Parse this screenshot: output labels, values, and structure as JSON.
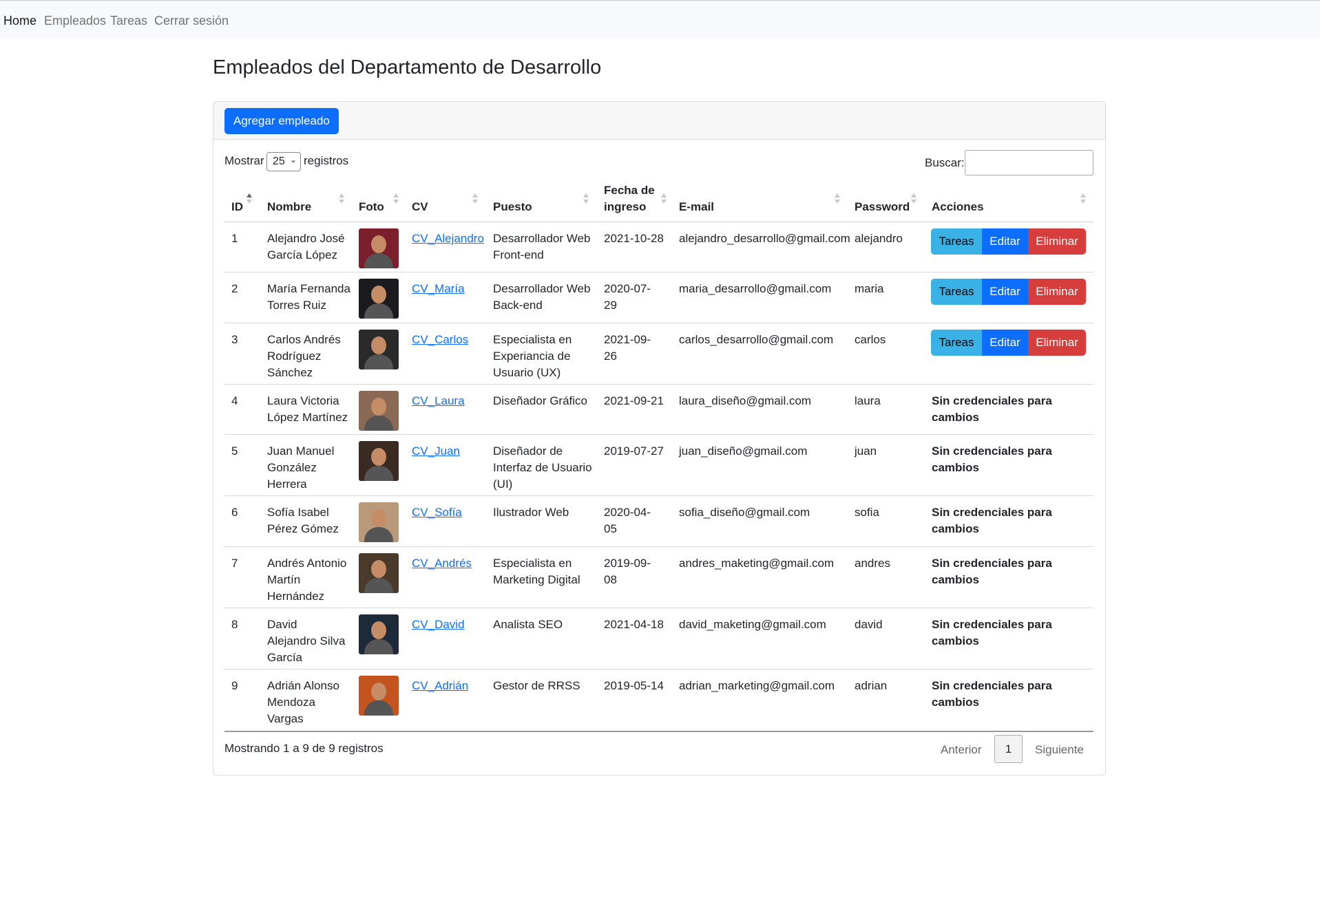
{
  "nav": {
    "items": [
      {
        "label": "Home",
        "active": true
      },
      {
        "label": "Empleados"
      },
      {
        "label": "Tareas"
      },
      {
        "label": "Cerrar sesión"
      }
    ]
  },
  "page_title": "Empleados del Departamento de Desarrollo",
  "card": {
    "add_button": "Agregar empleado"
  },
  "length_menu": {
    "prefix": "Mostrar",
    "value": "25",
    "suffix": "registros"
  },
  "search": {
    "label": "Buscar:",
    "value": ""
  },
  "table": {
    "headers": {
      "id": "ID",
      "nombre": "Nombre",
      "foto": "Foto",
      "cv": "CV",
      "puesto": "Puesto",
      "fecha_1": "Fecha de",
      "fecha_2": "ingreso",
      "email": "E-mail",
      "password": "Password",
      "acciones": "Acciones"
    },
    "action_labels": {
      "tareas": "Tareas",
      "editar": "Editar",
      "eliminar": "Eliminar"
    },
    "no_credentials": "Sin credenciales para cambios",
    "rows": [
      {
        "id": "1",
        "nombre": [
          "Alejandro José",
          "García López"
        ],
        "cv": "CV_Alejandro",
        "puesto": [
          "Desarrollador Web",
          "Front-end"
        ],
        "fecha": [
          "2021-10-28"
        ],
        "email": "alejandro_desarrollo@gmail.com",
        "password": "alejandro",
        "actions": true,
        "photo_color": "#7a1f2b"
      },
      {
        "id": "2",
        "nombre": [
          "María Fernanda",
          "Torres Ruiz"
        ],
        "cv": "CV_María",
        "puesto": [
          "Desarrollador Web",
          "Back-end"
        ],
        "fecha": [
          "2020-07-",
          "29"
        ],
        "email": "maria_desarrollo@gmail.com",
        "password": "maria",
        "actions": true,
        "photo_color": "#1b1b1f"
      },
      {
        "id": "3",
        "nombre": [
          "Carlos Andrés",
          "Rodríguez",
          "Sánchez"
        ],
        "cv": "CV_Carlos",
        "puesto": [
          "Especialista en",
          "Experiancia de",
          "Usuario (UX)"
        ],
        "fecha": [
          "2021-09-",
          "26"
        ],
        "email": "carlos_desarrollo@gmail.com",
        "password": "carlos",
        "actions": true,
        "photo_color": "#2a2a2a"
      },
      {
        "id": "4",
        "nombre": [
          "Laura Victoria",
          "López Martínez"
        ],
        "cv": "CV_Laura",
        "puesto": [
          "Diseñador Gráfico"
        ],
        "fecha": [
          "2021-09-21"
        ],
        "email": "laura_diseño@gmail.com",
        "password": "laura",
        "actions": false,
        "photo_color": "#8a6a55"
      },
      {
        "id": "5",
        "nombre": [
          "Juan Manuel",
          "González",
          "Herrera"
        ],
        "cv": "CV_Juan",
        "puesto": [
          "Diseñador de",
          "Interfaz de Usuario",
          "(UI)"
        ],
        "fecha": [
          "2019-07-27"
        ],
        "email": "juan_diseño@gmail.com",
        "password": "juan",
        "actions": false,
        "photo_color": "#3a2a22"
      },
      {
        "id": "6",
        "nombre": [
          "Sofía Isabel",
          "Pérez Gómez"
        ],
        "cv": "CV_Sofía",
        "puesto": [
          "Ilustrador Web"
        ],
        "fecha": [
          "2020-04-",
          "05"
        ],
        "email": "sofia_diseño@gmail.com",
        "password": "sofia",
        "actions": false,
        "photo_color": "#b89a7a"
      },
      {
        "id": "7",
        "nombre": [
          "Andrés Antonio",
          "Martín",
          "Hernández"
        ],
        "cv": "CV_Andrés",
        "puesto": [
          "Especialista en",
          "Marketing Digital"
        ],
        "fecha": [
          "2019-09-",
          "08"
        ],
        "email": "andres_maketing@gmail.com",
        "password": "andres",
        "actions": false,
        "photo_color": "#4a3a2a"
      },
      {
        "id": "8",
        "nombre": [
          "David",
          "Alejandro Silva",
          "García"
        ],
        "cv": "CV_David",
        "puesto": [
          "Analista SEO"
        ],
        "fecha": [
          "2021-04-18"
        ],
        "email": "david_maketing@gmail.com",
        "password": "david",
        "actions": false,
        "photo_color": "#1d2a3a"
      },
      {
        "id": "9",
        "nombre": [
          "Adrián Alonso",
          "Mendoza",
          "Vargas"
        ],
        "cv": "CV_Adrián",
        "puesto": [
          "Gestor de RRSS"
        ],
        "fecha": [
          "2019-05-14"
        ],
        "email": "adrian_marketing@gmail.com",
        "password": "adrian",
        "actions": false,
        "photo_color": "#c4541f"
      }
    ]
  },
  "footer": {
    "info": "Mostrando 1 a 9 de 9 registros",
    "prev": "Anterior",
    "page": "1",
    "next": "Siguiente"
  }
}
